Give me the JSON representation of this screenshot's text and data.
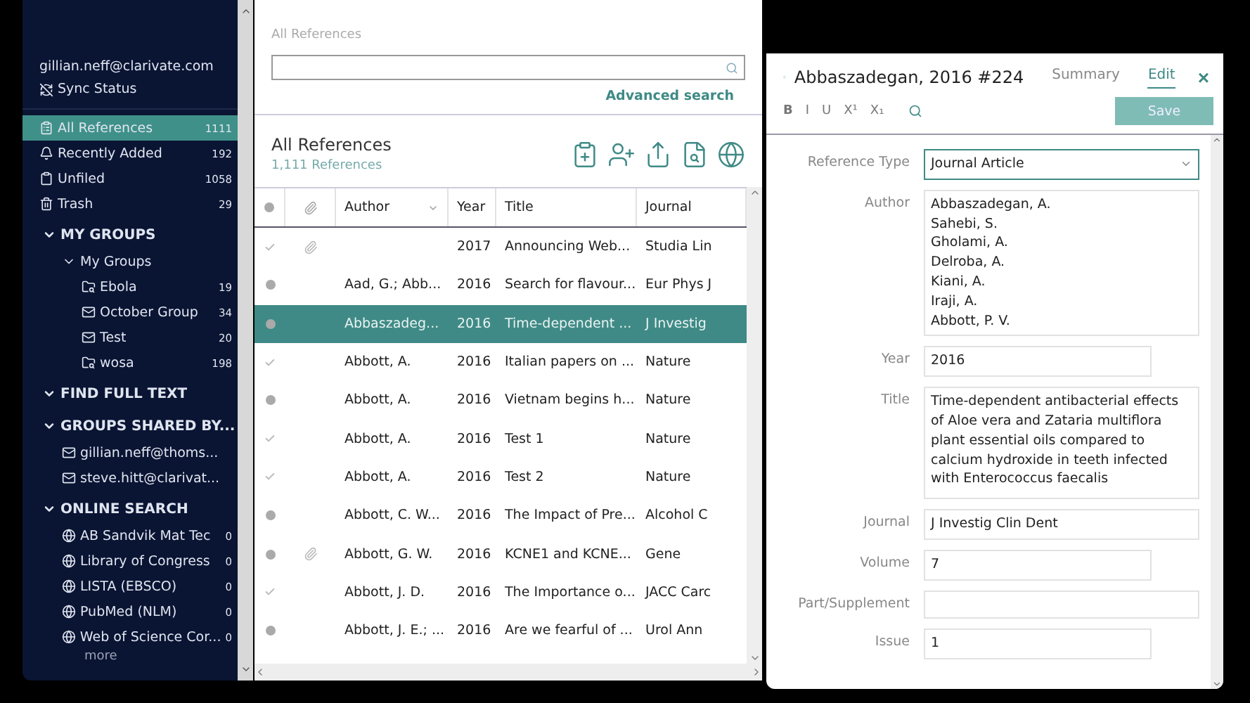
{
  "account": {
    "email": "gillian.neff@clarivate.com",
    "sync": "Sync Status"
  },
  "library": [
    {
      "kind": "all",
      "label": "All References",
      "count": "1111",
      "selected": true
    },
    {
      "kind": "recent",
      "label": "Recently Added",
      "count": "192",
      "selected": false
    },
    {
      "kind": "unfiled",
      "label": "Unfiled",
      "count": "1058",
      "selected": false
    },
    {
      "kind": "trash",
      "label": "Trash",
      "count": "29",
      "selected": false
    }
  ],
  "sections": [
    {
      "label": "MY GROUPS",
      "expanded": true,
      "children": [
        {
          "kind": "set",
          "label": "My Groups",
          "expanded": true,
          "children": [
            {
              "kind": "smart",
              "label": "Ebola",
              "count": "19"
            },
            {
              "kind": "group",
              "label": "October Group",
              "count": "34"
            },
            {
              "kind": "group",
              "label": "Test",
              "count": "20"
            },
            {
              "kind": "smart",
              "label": "wosa",
              "count": "198"
            }
          ]
        }
      ]
    },
    {
      "label": "FIND FULL TEXT",
      "expanded": true
    },
    {
      "label": "GROUPS SHARED BY...",
      "expanded": true,
      "children": [
        {
          "kind": "shared",
          "label": "gillian.neff@thoms..."
        },
        {
          "kind": "shared",
          "label": "steve.hitt@clarivat..."
        }
      ]
    },
    {
      "label": "ONLINE SEARCH",
      "expanded": true,
      "children": [
        {
          "kind": "online",
          "label": "AB Sandvik Mat Tec",
          "count": "0"
        },
        {
          "kind": "online",
          "label": "Library of Congress",
          "count": "0"
        },
        {
          "kind": "online",
          "label": "LISTA (EBSCO)",
          "count": "0"
        },
        {
          "kind": "online",
          "label": "PubMed (NLM)",
          "count": "0"
        },
        {
          "kind": "online",
          "label": "Web of Science Cor...",
          "count": "0"
        }
      ]
    }
  ],
  "more": "more",
  "breadcrumb": "All References",
  "search": {
    "link": "Advanced search"
  },
  "list": {
    "title": "All References",
    "subtitle": "1,111 References"
  },
  "columns": [
    "Author",
    "Year",
    "Title",
    "Journal"
  ],
  "rows": [
    {
      "read": true,
      "attachment": true,
      "selected": false,
      "author": "",
      "year": "2017",
      "title": "Announcing Web...",
      "journal": "Studia Lin"
    },
    {
      "read": false,
      "attachment": false,
      "selected": false,
      "author": "Aad, G.; Abb...",
      "year": "2016",
      "title": "Search for flavour...",
      "journal": "Eur Phys J"
    },
    {
      "read": false,
      "attachment": false,
      "selected": true,
      "author": "Abbaszadeg...",
      "year": "2016",
      "title": "Time-dependent ...",
      "journal": "J Investig"
    },
    {
      "read": true,
      "attachment": false,
      "selected": false,
      "author": "Abbott, A.",
      "year": "2016",
      "title": "Italian papers on ...",
      "journal": "Nature"
    },
    {
      "read": false,
      "attachment": false,
      "selected": false,
      "author": "Abbott, A.",
      "year": "2016",
      "title": "Vietnam begins h...",
      "journal": "Nature"
    },
    {
      "read": true,
      "attachment": false,
      "selected": false,
      "author": "Abbott, A.",
      "year": "2016",
      "title": "Test 1",
      "journal": "Nature"
    },
    {
      "read": true,
      "attachment": false,
      "selected": false,
      "author": "Abbott, A.",
      "year": "2016",
      "title": "Test 2",
      "journal": "Nature"
    },
    {
      "read": false,
      "attachment": false,
      "selected": false,
      "author": "Abbott, C. W...",
      "year": "2016",
      "title": "The Impact of Pre...",
      "journal": "Alcohol C"
    },
    {
      "read": false,
      "attachment": true,
      "selected": false,
      "author": "Abbott, G. W.",
      "year": "2016",
      "title": "KCNE1 and KCNE...",
      "journal": "Gene"
    },
    {
      "read": true,
      "attachment": false,
      "selected": false,
      "author": "Abbott, J. D.",
      "year": "2016",
      "title": "The Importance o...",
      "journal": "JACC Carc"
    },
    {
      "read": false,
      "attachment": false,
      "selected": false,
      "author": "Abbott, J. E.; ...",
      "year": "2016",
      "title": "Are we fearful of ...",
      "journal": "Urol Ann"
    }
  ],
  "editor": {
    "title": "Abbaszadegan, 2016 #224",
    "tabs": [
      {
        "label": "Summary",
        "selected": false
      },
      {
        "label": "Edit",
        "selected": true
      }
    ],
    "close": "×",
    "format": [
      "B",
      "I",
      "U",
      "X¹",
      "X₁"
    ],
    "save": "Save",
    "fields": [
      {
        "kind": "select",
        "label": "Reference Type",
        "value": "Journal Article",
        "wide": true
      },
      {
        "kind": "lines",
        "label": "Author",
        "lines": [
          "Abbaszadegan, A.",
          "Sahebi, S.",
          "Gholami, A.",
          "Delroba, A.",
          "Kiani, A.",
          "Iraji, A.",
          "Abbott, P. V."
        ],
        "wide": true
      },
      {
        "kind": "text",
        "label": "Year",
        "value": "2016",
        "wide": false
      },
      {
        "kind": "area",
        "label": "Title",
        "value": "Time-dependent antibacterial effects of Aloe vera and Zataria multiflora plant essential oils compared to calcium hydroxide in teeth infected with Enterococcus faecalis",
        "wide": true
      },
      {
        "kind": "text",
        "label": "Journal",
        "value": "J Investig Clin Dent",
        "wide": true
      },
      {
        "kind": "text",
        "label": "Volume",
        "value": "7",
        "wide": false
      },
      {
        "kind": "text",
        "label": "Part/Supplement",
        "wide": true
      },
      {
        "kind": "text",
        "label": "Issue",
        "value": "1",
        "wide": false
      }
    ]
  }
}
